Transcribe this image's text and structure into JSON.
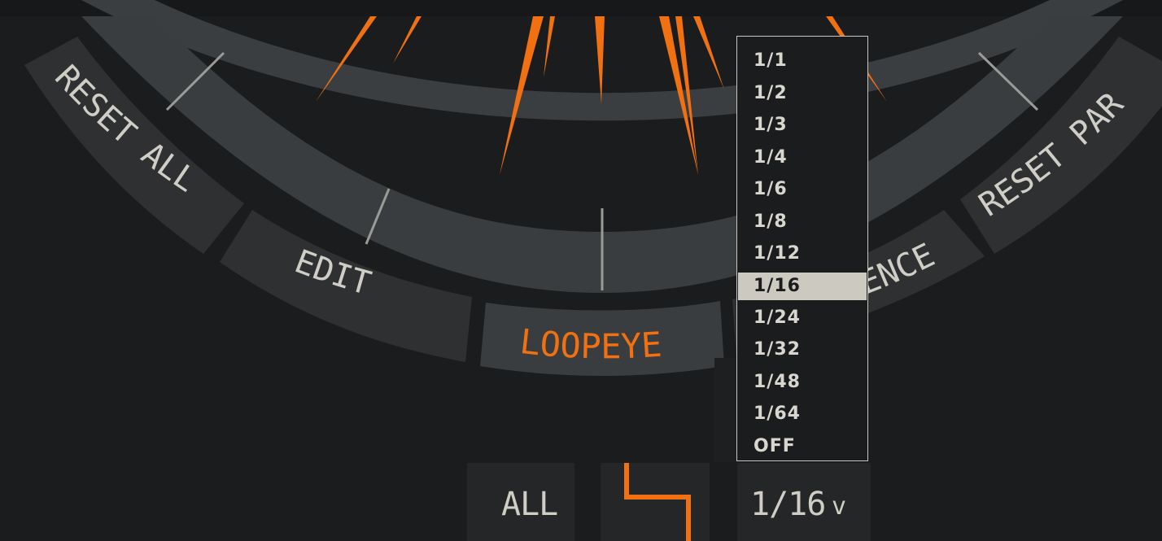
{
  "ring_buttons": {
    "reset_all": "RESET ALL",
    "edit": "EDIT",
    "loopeye": "LOOPEYE",
    "sequence_partial": "ENCE",
    "reset_par": "RESET PAR"
  },
  "dropdown": {
    "options": [
      "1/1",
      "1/2",
      "1/3",
      "1/4",
      "1/6",
      "1/8",
      "1/12",
      "1/16",
      "1/24",
      "1/32",
      "1/48",
      "1/64",
      "OFF"
    ],
    "selected": "1/16"
  },
  "bottom_bar": {
    "all_label": "ALL",
    "rate_value": "1/16",
    "rate_caret": "v"
  },
  "colors": {
    "accent": "#f07012",
    "background": "#1b1c1e",
    "ring": "#3c3f41",
    "button": "#2e3032",
    "text": "#cfcdc6"
  }
}
